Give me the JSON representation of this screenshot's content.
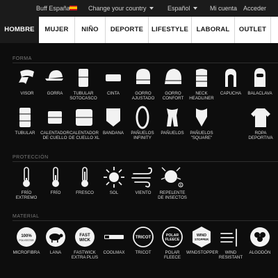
{
  "topbar": {
    "country": "Buff España",
    "change_country": "Change your country",
    "language": "Español",
    "account": "Mi cuenta",
    "login": "Acceder"
  },
  "nav": {
    "tabs": [
      {
        "label": "HOMBRE",
        "active": true
      },
      {
        "label": "MUJER",
        "active": false
      },
      {
        "label": "NIÑO",
        "active": false
      },
      {
        "label": "DEPORTE",
        "active": false
      },
      {
        "label": "LIFESTYLE",
        "active": false
      },
      {
        "label": "LABORAL",
        "active": false
      },
      {
        "label": "OUTLET",
        "active": false
      }
    ]
  },
  "sections": {
    "forma": {
      "title": "FORMA",
      "row1": [
        {
          "label1": "VISOR",
          "label2": "",
          "icon": "visor-icon"
        },
        {
          "label1": "GORRA",
          "label2": "",
          "icon": "cap-icon"
        },
        {
          "label1": "TUBULAR",
          "label2": "SOTOCASCO",
          "icon": "helmet-liner-icon"
        },
        {
          "label1": "CINTA",
          "label2": "",
          "icon": "headband-icon"
        },
        {
          "label1": "GORRO",
          "label2": "AJUSTADO",
          "icon": "fitted-hat-icon"
        },
        {
          "label1": "GORRO",
          "label2": "CONFORT",
          "icon": "comfort-hat-icon"
        },
        {
          "label1": "NECK",
          "label2": "HEADLINER",
          "icon": "neck-headliner-icon"
        },
        {
          "label1": "CAPUCHA",
          "label2": "",
          "icon": "hood-icon"
        },
        {
          "label1": "BALACLAVA",
          "label2": "",
          "icon": "balaclava-icon"
        }
      ],
      "row2": [
        {
          "label1": "TUBULAR",
          "label2": "",
          "icon": "tubular-icon"
        },
        {
          "label1": "CALENTADOR",
          "label2": "DE CUELLO",
          "icon": "neck-warmer-icon"
        },
        {
          "label1": "CALENTADOR",
          "label2": "DE CUELLO XL",
          "icon": "neck-warmer-xl-icon"
        },
        {
          "label1": "BANDANA",
          "label2": "",
          "icon": "bandana-icon"
        },
        {
          "label1": "PAÑUELOS",
          "label2": "INFINITY",
          "icon": "infinity-scarf-icon"
        },
        {
          "label1": "PAÑUELOS",
          "label2": "",
          "icon": "scarf-icon"
        },
        {
          "label1": "PAÑUELOS",
          "label2": "\"SQUARE\"",
          "icon": "square-scarf-icon"
        },
        {
          "label1": "ROPA",
          "label2": "DEPORTIVA",
          "icon": "sportswear-icon"
        }
      ]
    },
    "proteccion": {
      "title": "PROTECCIÓN",
      "items": [
        {
          "label1": "FRÍO",
          "label2": "EXTREMO",
          "icon": "thermometer-extreme-icon"
        },
        {
          "label1": "FRÍO",
          "label2": "",
          "icon": "thermometer-cold-icon"
        },
        {
          "label1": "FRESCO",
          "label2": "",
          "icon": "thermometer-cool-icon"
        },
        {
          "label1": "SOL",
          "label2": "",
          "icon": "sun-icon"
        },
        {
          "label1": "VIENTO",
          "label2": "",
          "icon": "wind-icon"
        },
        {
          "label1": "REPELENTE",
          "label2": "DE INSECTOS",
          "icon": "insect-repellent-icon"
        }
      ]
    },
    "material": {
      "title": "MATERIAL",
      "items": [
        {
          "label1": "MICROFIBRA",
          "label2": "",
          "badge": "100%",
          "badge2": "POLYESTER",
          "icon": "microfiber-icon"
        },
        {
          "label1": "LANA",
          "label2": "",
          "badge": "",
          "badge2": "",
          "icon": "wool-sheep-icon"
        },
        {
          "label1": "FASTWICK",
          "label2": "EXTRA PLUS",
          "badge": "FAST",
          "badge2": "WICK",
          "icon": "fastwick-icon"
        },
        {
          "label1": "COOLMAX",
          "label2": "",
          "badge": "",
          "badge2": "",
          "icon": "coolmax-icon"
        },
        {
          "label1": "TRICOT",
          "label2": "",
          "badge": "TRICOT",
          "badge2": "",
          "icon": "tricot-icon"
        },
        {
          "label1": "POLAR",
          "label2": "FLEECE",
          "badge": "POLAR",
          "badge2": "FLEECE",
          "icon": "polar-fleece-icon"
        },
        {
          "label1": "WINDSTOPPER",
          "label2": "",
          "badge": "WIND",
          "badge2": "STOPPER",
          "icon": "windstopper-icon"
        },
        {
          "label1": "WIND",
          "label2": "RESISTANT",
          "badge": "",
          "badge2": "",
          "icon": "wind-resistant-icon"
        },
        {
          "label1": "ALGODÓN",
          "label2": "",
          "badge": "",
          "badge2": "",
          "icon": "cotton-icon"
        }
      ]
    }
  }
}
